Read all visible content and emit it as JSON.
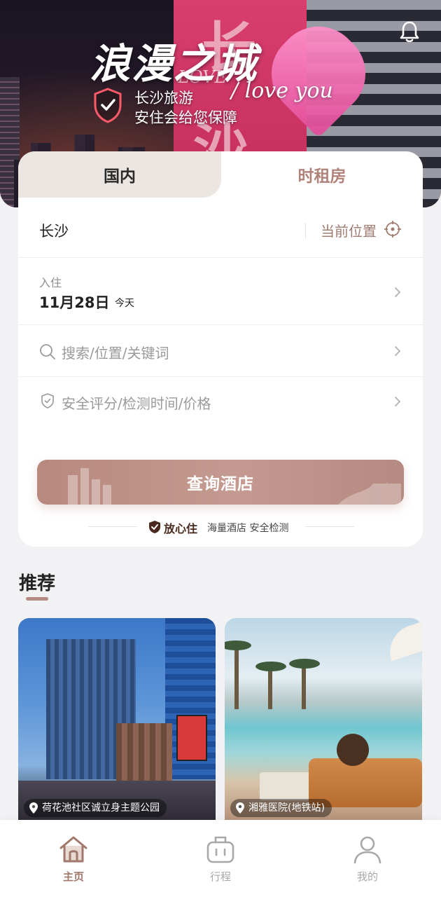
{
  "banner": {
    "headline": "浪漫之城",
    "tagline_line1": "长沙旅游",
    "tagline_line2": "安住会给您保障",
    "script_text": "/ love you",
    "sign_char_top": "长",
    "sign_char_bottom": "沙",
    "sign_love": "LOVE",
    "bell_icon": "bell-icon"
  },
  "tabs": {
    "domestic": "国内",
    "hourly": "时租房"
  },
  "location": {
    "city": "长沙",
    "current_location": "当前位置",
    "icon": "crosshair-icon"
  },
  "checkin": {
    "label": "入住",
    "date": "11月28日",
    "relative": "今天"
  },
  "search": {
    "placeholder": "搜索/位置/关键词",
    "icon": "search-icon"
  },
  "filter": {
    "placeholder": "安全评分/检测时间/价格",
    "icon": "shield-check-icon"
  },
  "query_button": "查询酒店",
  "assurance": {
    "badge": "放心住",
    "description": "海量酒店 安全检测"
  },
  "recommend": {
    "title": "推荐",
    "items": [
      {
        "location": "荷花池社区诚立身主题公园"
      },
      {
        "location": "湘雅医院(地铁站)"
      }
    ]
  },
  "bottom_nav": {
    "items": [
      {
        "label": "主页",
        "icon": "home-icon",
        "active": true
      },
      {
        "label": "行程",
        "icon": "luggage-icon",
        "active": false
      },
      {
        "label": "我的",
        "icon": "user-icon",
        "active": false
      }
    ]
  },
  "colors": {
    "accent": "#b58a80",
    "accent_text": "#a07c73",
    "background": "#f2f2f4",
    "card": "#ffffff"
  }
}
